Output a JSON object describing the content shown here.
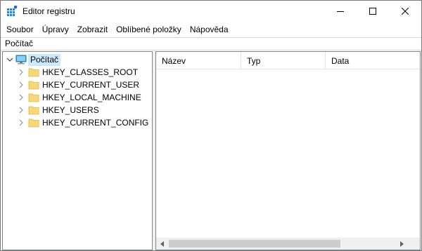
{
  "window": {
    "title": "Editor registru",
    "icon": "registry-editor-icon"
  },
  "menu": [
    "Soubor",
    "Úpravy",
    "Zobrazit",
    "Oblíbené položky",
    "Nápověda"
  ],
  "address": "Počítač",
  "tree": {
    "root": {
      "label": "Počítač",
      "icon": "computer-icon",
      "expanded": true,
      "selected": true
    },
    "hives": [
      {
        "label": "HKEY_CLASSES_ROOT"
      },
      {
        "label": "HKEY_CURRENT_USER"
      },
      {
        "label": "HKEY_LOCAL_MACHINE"
      },
      {
        "label": "HKEY_USERS"
      },
      {
        "label": "HKEY_CURRENT_CONFIG"
      }
    ]
  },
  "list": {
    "columns": [
      "Název",
      "Typ",
      "Data"
    ]
  },
  "colors": {
    "selection": "#cce8ff",
    "folder": "#f8d775",
    "accent": "#0078d7"
  }
}
